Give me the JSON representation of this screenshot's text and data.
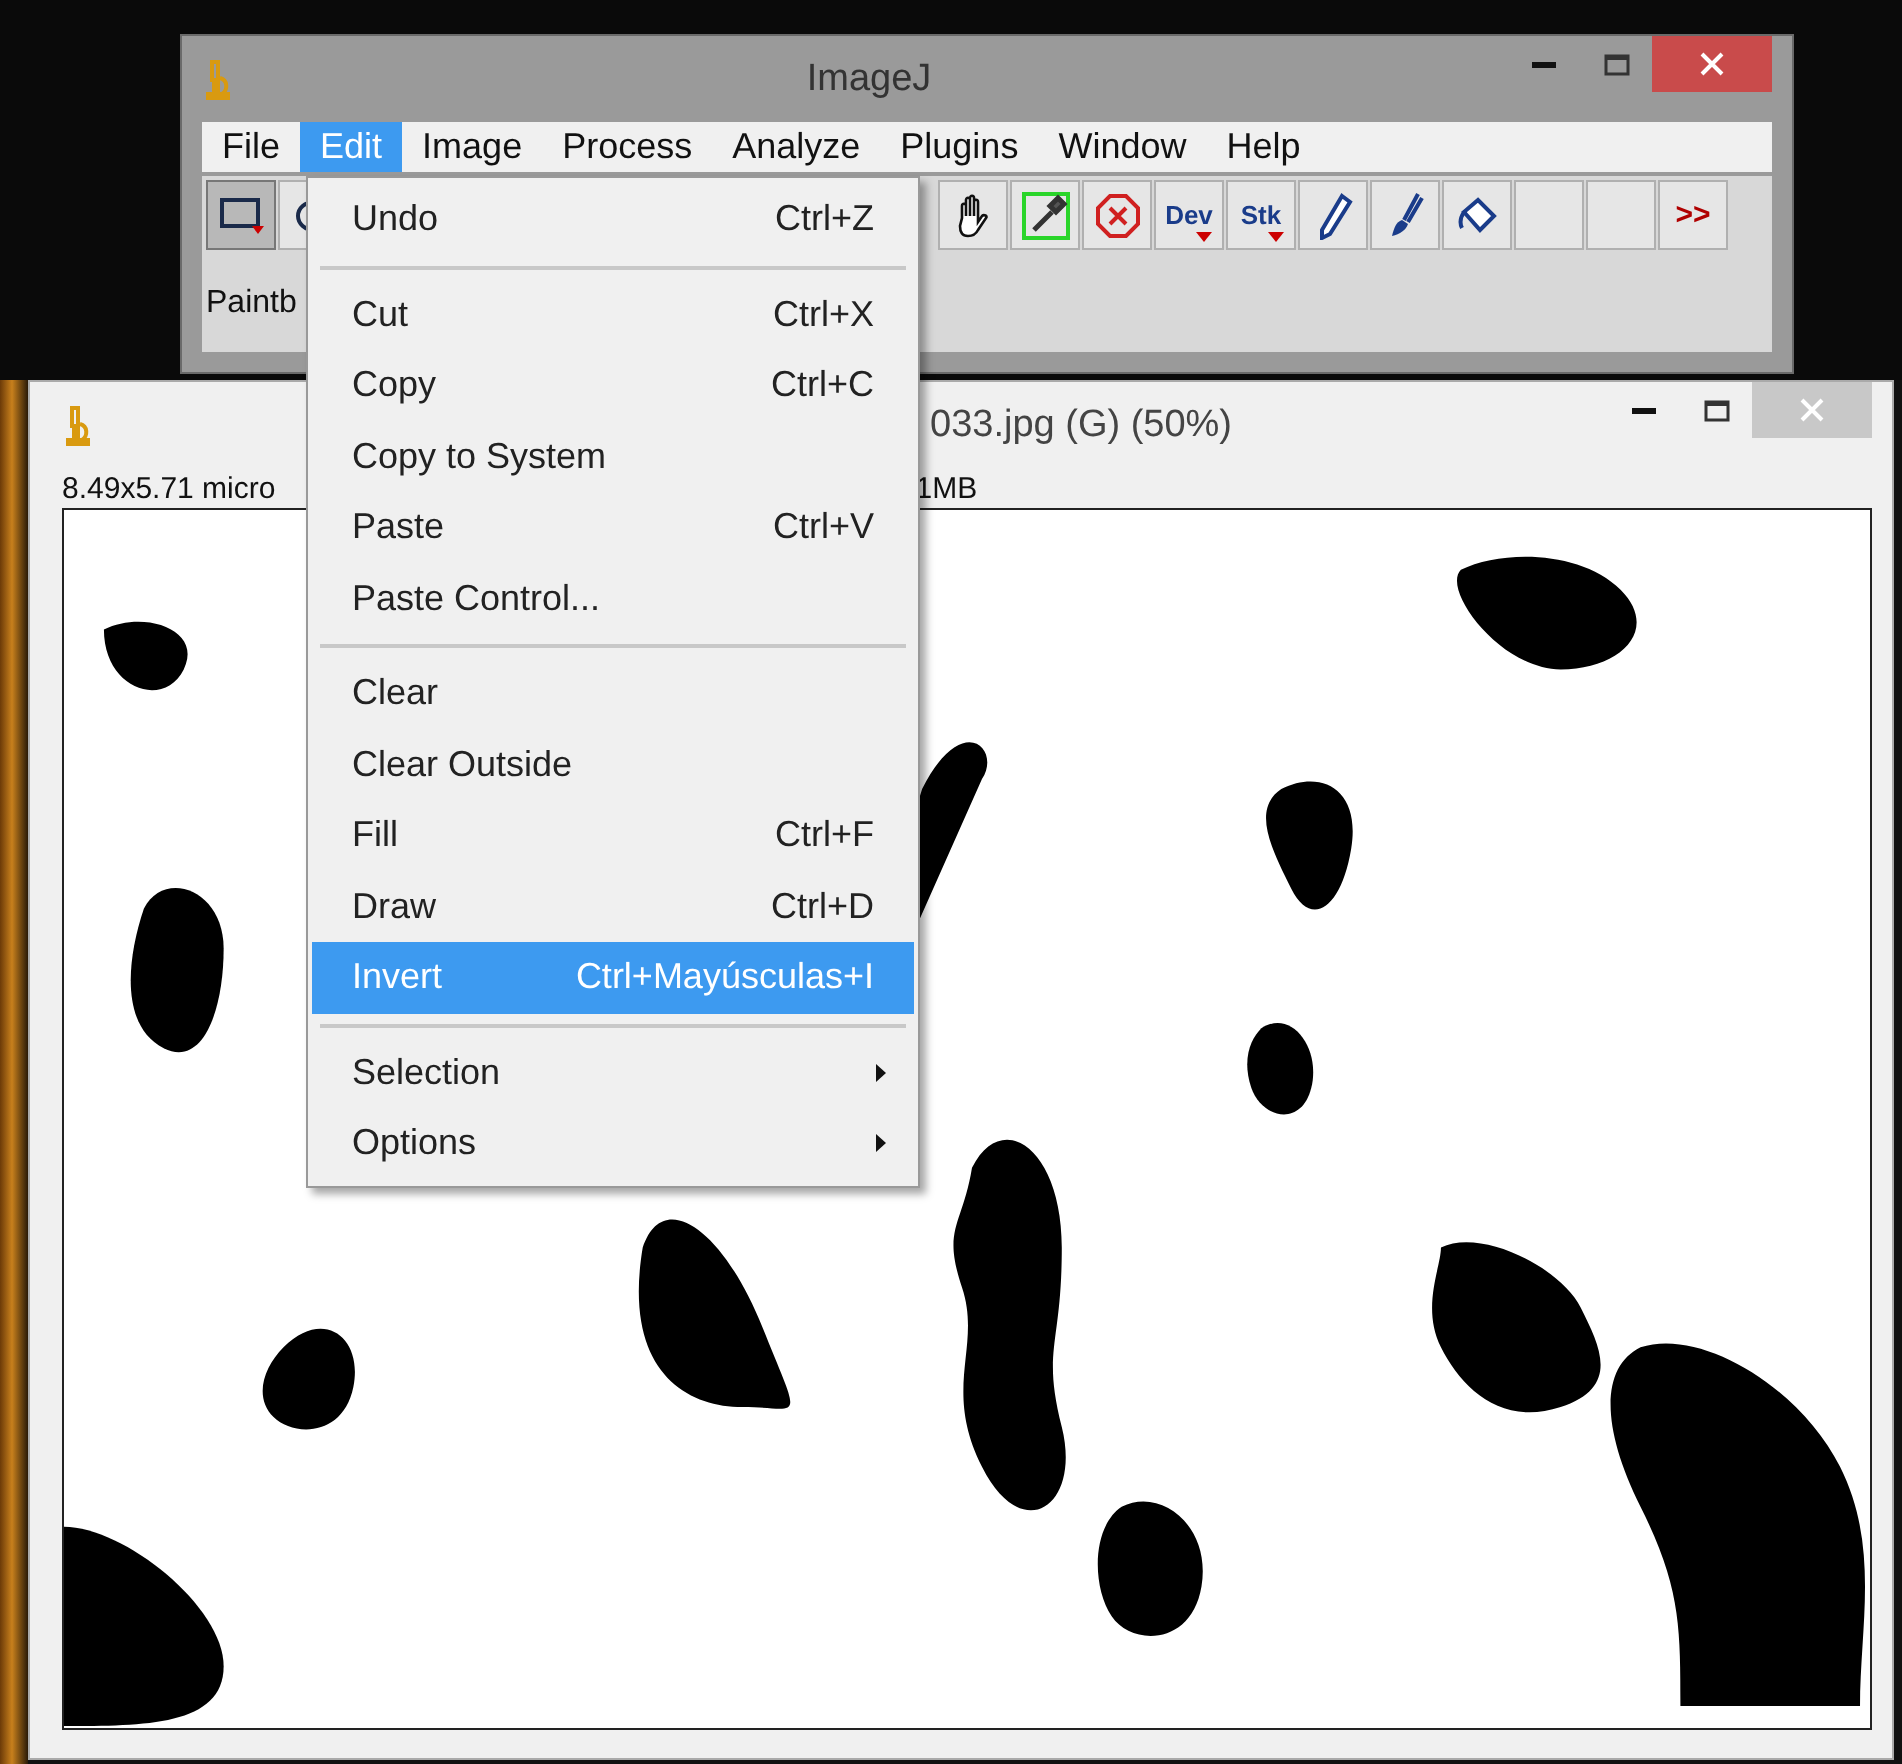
{
  "main_window": {
    "title": "ImageJ",
    "menu": [
      {
        "label": "File",
        "selected": false
      },
      {
        "label": "Edit",
        "selected": true
      },
      {
        "label": "Image",
        "selected": false
      },
      {
        "label": "Process",
        "selected": false
      },
      {
        "label": "Analyze",
        "selected": false
      },
      {
        "label": "Plugins",
        "selected": false
      },
      {
        "label": "Window",
        "selected": false
      },
      {
        "label": "Help",
        "selected": false
      }
    ],
    "toolbar": [
      {
        "kind": "rectangle",
        "selected": true
      },
      {
        "kind": "oval",
        "selected": false
      },
      {
        "kind": "gap"
      },
      {
        "kind": "hand",
        "selected": false
      },
      {
        "kind": "dropper",
        "selected": false
      },
      {
        "kind": "stop",
        "selected": false
      },
      {
        "kind": "text",
        "label": "Dev",
        "selected": false
      },
      {
        "kind": "text",
        "label": "Stk",
        "selected": false
      },
      {
        "kind": "pencil",
        "selected": false
      },
      {
        "kind": "brush",
        "selected": false
      },
      {
        "kind": "bucket",
        "selected": false
      },
      {
        "kind": "empty",
        "selected": false
      },
      {
        "kind": "empty",
        "selected": false
      },
      {
        "kind": "more",
        "label": ">>",
        "selected": false
      }
    ],
    "status": "Paintb"
  },
  "image_window": {
    "title": "033.jpg (G) (50%)",
    "info": [
      "8.49x5.71 micro",
      "1MB"
    ]
  },
  "edit_menu": {
    "items": [
      {
        "kind": "item",
        "label": "Undo",
        "shortcut": "Ctrl+Z",
        "selected": false
      },
      {
        "kind": "separator"
      },
      {
        "kind": "item",
        "label": "Cut",
        "shortcut": "Ctrl+X",
        "selected": false
      },
      {
        "kind": "item",
        "label": "Copy",
        "shortcut": "Ctrl+C",
        "selected": false
      },
      {
        "kind": "item",
        "label": "Copy to System",
        "selected": false
      },
      {
        "kind": "item",
        "label": "Paste",
        "shortcut": "Ctrl+V",
        "selected": false
      },
      {
        "kind": "item",
        "label": "Paste Control...",
        "selected": false
      },
      {
        "kind": "separator"
      },
      {
        "kind": "item",
        "label": "Clear",
        "selected": false
      },
      {
        "kind": "item",
        "label": "Clear Outside",
        "selected": false
      },
      {
        "kind": "item",
        "label": "Fill",
        "shortcut": "Ctrl+F",
        "selected": false
      },
      {
        "kind": "item",
        "label": "Draw",
        "shortcut": "Ctrl+D",
        "selected": false
      },
      {
        "kind": "item",
        "label": "Invert",
        "shortcut": "Ctrl+Mayúsculas+I",
        "selected": true
      },
      {
        "kind": "separator"
      },
      {
        "kind": "submenu",
        "label": "Selection",
        "selected": false
      },
      {
        "kind": "submenu",
        "label": "Options",
        "selected": false
      }
    ]
  }
}
